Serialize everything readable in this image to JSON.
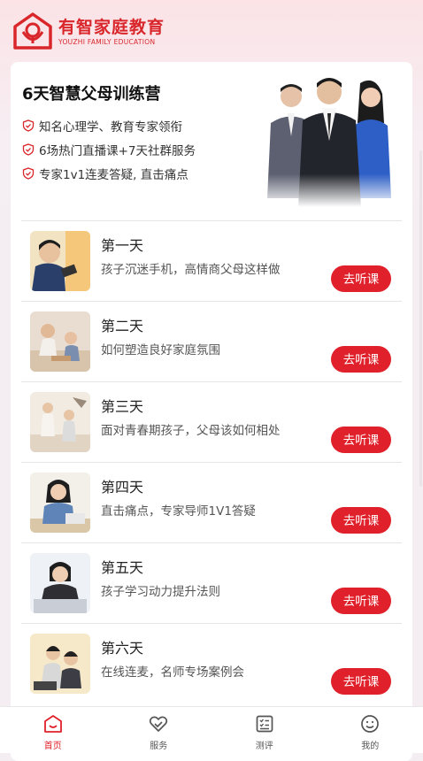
{
  "brand": {
    "name_cn": "有智家庭教育",
    "name_en": "YOUZHI FAMILY EDUCATION",
    "color": "#d9262b"
  },
  "banner": {
    "title": "6天智慧父母训练营",
    "features": [
      "知名心理学、教育专家领衔",
      "6场热门直播课+7天社群服务",
      "专家1v1连麦答疑, 直击痛点"
    ]
  },
  "lessons": [
    {
      "day": "第一天",
      "desc": "孩子沉迷手机，高情商父母这样做",
      "button": "去听课"
    },
    {
      "day": "第二天",
      "desc": "如何塑造良好家庭氛围",
      "button": "去听课"
    },
    {
      "day": "第三天",
      "desc": "面对青春期孩子，父母该如何相处",
      "button": "去听课"
    },
    {
      "day": "第四天",
      "desc": "直击痛点，专家导师1V1答疑",
      "button": "去听课"
    },
    {
      "day": "第五天",
      "desc": "孩子学习动力提升法则",
      "button": "去听课"
    },
    {
      "day": "第六天",
      "desc": "在线连麦，名师专场案例会",
      "button": "去听课"
    }
  ],
  "tabbar": {
    "items": [
      {
        "label": "首页",
        "icon": "home-icon",
        "active": true
      },
      {
        "label": "服务",
        "icon": "heart-hand-icon",
        "active": false
      },
      {
        "label": "测评",
        "icon": "checklist-icon",
        "active": false
      },
      {
        "label": "我的",
        "icon": "smile-face-icon",
        "active": false
      }
    ]
  },
  "colors": {
    "accent": "#e0202a",
    "background": "#f4eef3"
  }
}
